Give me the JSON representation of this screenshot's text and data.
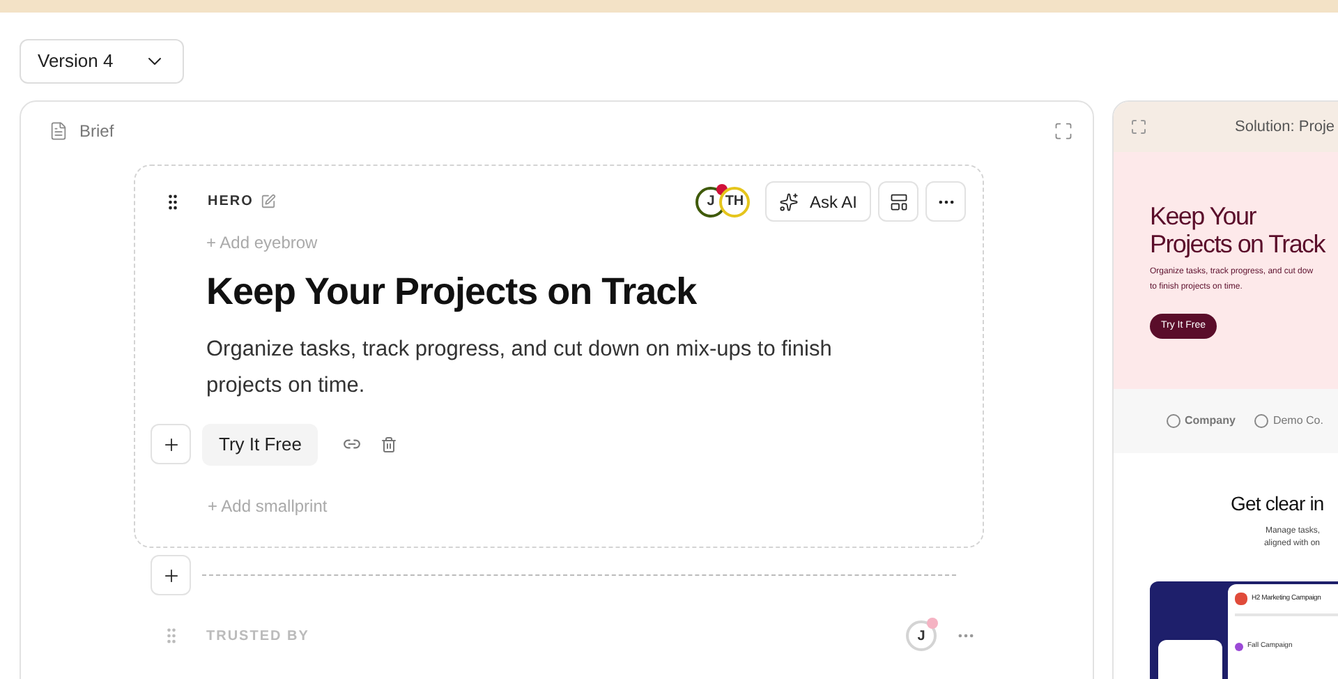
{
  "version_select": {
    "value": "Version 4"
  },
  "brief_panel": {
    "title": "Brief",
    "hero": {
      "label": "HERO",
      "collaborators": [
        {
          "initials": "J",
          "color": "#3f5a0a",
          "online": true
        },
        {
          "initials": "TH",
          "color": "#e5c51c",
          "online": false
        }
      ],
      "ask_ai": "Ask AI",
      "add_eyebrow": "+ Add eyebrow",
      "heading": "Keep Your Projects on Track",
      "body": "Organize tasks, track progress, and cut down on mix-ups to finish projects on time.",
      "cta": "Try It Free",
      "add_smallprint": "+ Add smallprint"
    },
    "next_section": {
      "label": "TRUSTED BY",
      "collaborators": [
        {
          "initials": "J",
          "color": "#d4d4d4",
          "online": true
        }
      ]
    }
  },
  "preview_panel": {
    "title": "Solution: Proje",
    "hero_heading": [
      "Keep Your",
      "Projects on Track"
    ],
    "hero_body": [
      "Organize tasks, track progress, and cut dow",
      "to finish projects on time."
    ],
    "hero_cta": "Try It Free",
    "logos": [
      "Company",
      "Demo Co."
    ],
    "feature_heading": "Get clear in",
    "feature_body": [
      "Manage tasks,",
      "aligned with on"
    ],
    "app_mockup": {
      "title": "H2 Marketing Campaign",
      "rows": [
        "Fall Campaign"
      ]
    }
  }
}
